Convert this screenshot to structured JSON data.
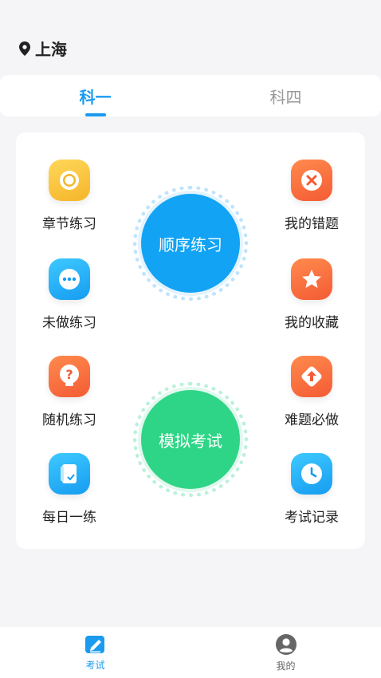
{
  "header": {
    "location": "上海"
  },
  "tabs": [
    {
      "label": "科一",
      "active": true
    },
    {
      "label": "科四",
      "active": false
    }
  ],
  "features_left": [
    {
      "label": "章节练习",
      "icon": "target-icon",
      "color": "yellow"
    },
    {
      "label": "未做练习",
      "icon": "chat-dots-icon",
      "color": "blue"
    },
    {
      "label": "随机练习",
      "icon": "question-bulb-icon",
      "color": "orange"
    },
    {
      "label": "每日一练",
      "icon": "notebook-icon",
      "color": "blue"
    }
  ],
  "features_right": [
    {
      "label": "我的错题",
      "icon": "close-circle-icon",
      "color": "orange"
    },
    {
      "label": "我的收藏",
      "icon": "star-icon",
      "color": "orange"
    },
    {
      "label": "难题必做",
      "icon": "arrow-up-diamond-icon",
      "color": "orange"
    },
    {
      "label": "考试记录",
      "icon": "clock-icon",
      "color": "blue"
    }
  ],
  "center_buttons": {
    "order_practice": "顺序练习",
    "mock_exam": "模拟考试"
  },
  "bottom_nav": [
    {
      "label": "考试",
      "icon": "exam-edit-icon",
      "active": true
    },
    {
      "label": "我的",
      "icon": "user-avatar-icon",
      "active": false
    }
  ],
  "colors": {
    "accent": "#1a9bf0",
    "order_button": "#12a3f4",
    "exam_button": "#2fd586"
  }
}
